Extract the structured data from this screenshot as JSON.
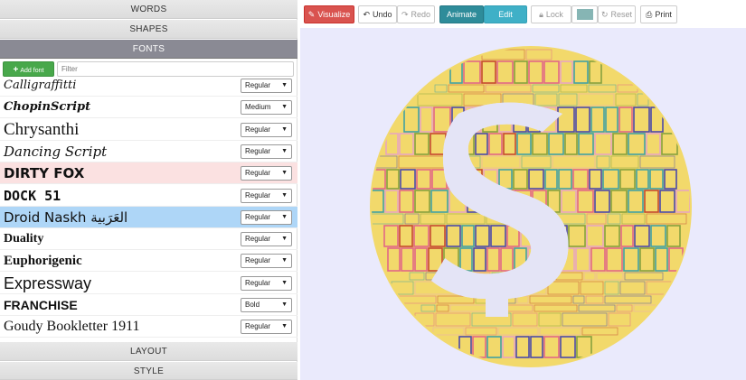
{
  "left_panel": {
    "accordion": {
      "words": "WORDS",
      "shapes": "SHAPES",
      "fonts": "FONTS",
      "layout": "LAYOUT",
      "style": "STYLE"
    },
    "add_font_label": "Add font",
    "filter_placeholder": "Filter",
    "fonts": [
      {
        "name": "Calligraffitti",
        "weight": "Regular"
      },
      {
        "name": "ChopinScript",
        "weight": "Medium"
      },
      {
        "name": "Chrysanthi",
        "weight": "Regular"
      },
      {
        "name": "Dancing Script",
        "weight": "Regular"
      },
      {
        "name": "DIRTY FOX",
        "weight": "Regular"
      },
      {
        "name": "DOCK 51",
        "weight": "Regular"
      },
      {
        "name": "Droid Naskh العَرَبية",
        "weight": "Regular"
      },
      {
        "name": "Duality",
        "weight": "Regular"
      },
      {
        "name": "Euphorigenic",
        "weight": "Regular"
      },
      {
        "name": "Expressway",
        "weight": "Regular"
      },
      {
        "name": "FRANCHISE",
        "weight": "Bold"
      },
      {
        "name": "Goudy Bookletter 1911",
        "weight": "Regular"
      }
    ]
  },
  "toolbar": {
    "visualize": "Visualize",
    "undo": "Undo",
    "redo": "Redo",
    "animate": "Animate",
    "edit": "Edit",
    "lock": "Lock",
    "reset": "Reset",
    "print": "Print",
    "color_value": "#86b5b4"
  },
  "canvas": {
    "background": "#eaeafc",
    "circle_fill": "#f2d96b",
    "dollar_fill": "#e4e4f6",
    "word_colors": [
      "#3a3ab0",
      "#e05a8a",
      "#2f9aa8",
      "#c0392b",
      "#e8a0c8",
      "#7a9a3a"
    ]
  }
}
